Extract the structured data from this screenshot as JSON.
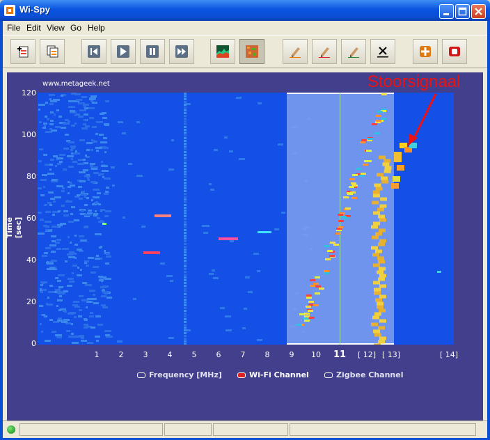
{
  "window": {
    "title": "Wi-Spy"
  },
  "menu": [
    "File",
    "Edit",
    "View",
    "Go",
    "Help"
  ],
  "toolbar": {
    "buttons": [
      "new-session",
      "copy-report",
      "rewind",
      "play",
      "pause",
      "fast-forward",
      "topographic-view",
      "density-view",
      "pencil-orange",
      "pencil-red",
      "pencil-green",
      "erase-marker",
      "crosshair",
      "record"
    ]
  },
  "chart_data": {
    "type": "heatmap",
    "url": "www.metageek.net",
    "annotation": "Stoorsignaal",
    "ylabel": "Time [sec]",
    "ylim": [
      0,
      120
    ],
    "y_ticks": [
      0,
      20,
      40,
      60,
      80,
      100,
      120
    ],
    "x_ticks": [
      "1",
      "2",
      "3",
      "4",
      "5",
      "6",
      "7",
      "8",
      "9",
      "10",
      "11",
      "[ 12]",
      "[ 13]",
      "[ 14]"
    ],
    "selected_channel": "11",
    "legend": [
      "Frequency [MHz]",
      "Wi-Fi Channel",
      "Zigbee Channel"
    ],
    "colors": {
      "background": "#1450e6",
      "selection": "#7ea0ee",
      "legend_wifi": "#e02020",
      "plot_frame": "#423f8c"
    }
  },
  "status": {
    "connected_indicator": "green-led"
  }
}
